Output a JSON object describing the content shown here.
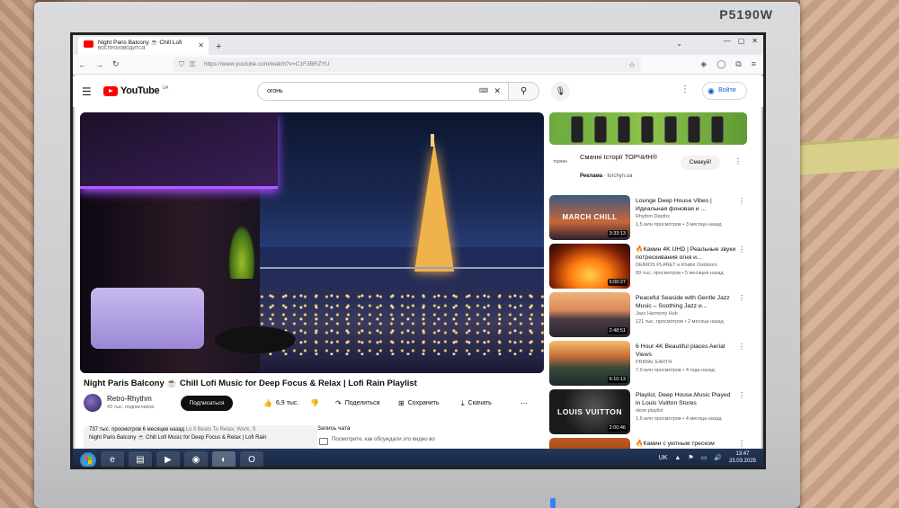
{
  "monitor": {
    "brand": "P5190W"
  },
  "browser": {
    "tab_title": "Night Paris Balcony ☕ Chill Lofi",
    "tab_status": "ВОСПРОИЗВОДИТСЯ",
    "url": "https://www.youtube.com/watch?v=C1F3BRZYU"
  },
  "youtube": {
    "logo": "YouTube",
    "country": "UA",
    "search_value": "огонь",
    "signin": "Войти"
  },
  "video": {
    "title": "Night Paris Balcony ☕ Chill Lofi Music for Deep Focus & Relax | Lofi Rain Playlist",
    "channel": "Retro-Rhythm",
    "subscribers": "43 тыс. подписчиков",
    "subscribe": "Подписаться",
    "likes": "6,9 тыс.",
    "share": "Поделиться",
    "save": "Сохранить",
    "download": "Скачать",
    "views_date": "737 тыс. просмотров  6 месяцев назад",
    "tags": "Lo fi Beats To Relax, Work, S",
    "desc_line": "Night Paris Balcony ☕ Chill Lofi Music for Deep Focus & Relax | Lofi Rain"
  },
  "chat": {
    "header": "Запись чата",
    "msg": "Посмотрите, как обсуждали это видео во"
  },
  "ad": {
    "brand": "торчин",
    "title": "Смачні Історії ТОРЧИН®",
    "label": "Реклама",
    "domain": "torchyn.ua",
    "cta": "Смакуй!"
  },
  "recs": [
    {
      "title": "Lounge Deep House Vibes | Идеальная фоновая и ...",
      "channel": "Rhythm Depths",
      "views": "1,5 млн просмотров • 3 месяца назад",
      "duration": "3:33:13",
      "thumb_text": "MARCH CHILL"
    },
    {
      "title": "🔥Камин 4K UHD | Реальные звуки потрескивания огня и...",
      "channel": "DEIMOS PLANET и Khabir Outdoors",
      "views": "89 тыс. просмотров • 5 месяцев назад",
      "duration": "5:00:27",
      "thumb_text": ""
    },
    {
      "title": "Peaceful Seaside with Gentle Jazz Music – Soothing Jazz и...",
      "channel": "Jazz Harmony Hub",
      "views": "121 тыс. просмотров • 2 месяца назад",
      "duration": "2:48:51",
      "thumb_text": ""
    },
    {
      "title": "6 Hour 4K Beautiful places Aerial Views",
      "channel": "PRIMAL EARTH",
      "views": "7,9 млн просмотров • 4 года назад",
      "duration": "6:10:13",
      "thumb_text": ""
    },
    {
      "title": "Playlist, Deep House,Music Played in Louis Vuitton Stores",
      "channel": "store playlist",
      "views": "1,6 млн просмотров • 4 месяца назад",
      "duration": "2:00:46",
      "thumb_text": "LOUIS VUITTON"
    },
    {
      "title": "🔥Камин с уютным треском",
      "channel": "",
      "views": "",
      "duration": "",
      "thumb_text": ""
    }
  ],
  "taskbar": {
    "lang": "UK",
    "time": "13:47",
    "date": "23.03.2025"
  },
  "colors": {
    "accent": "#ff0000",
    "subscribe_bg": "#0f0f0f",
    "link": "#065fd4"
  }
}
